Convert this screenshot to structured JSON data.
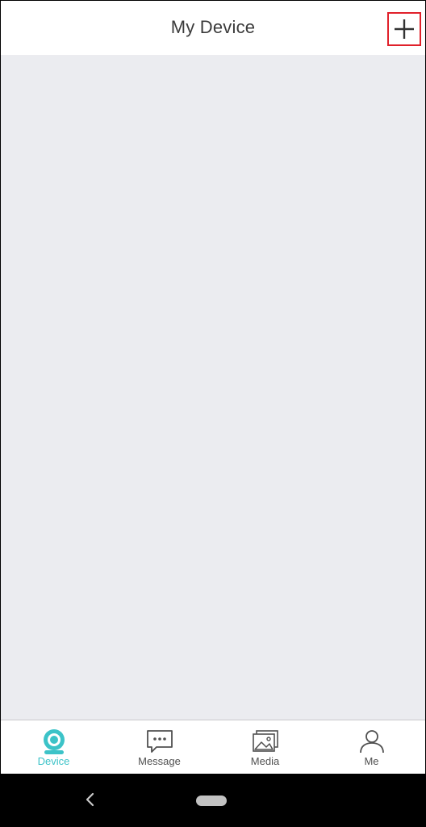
{
  "header": {
    "title": "My Device",
    "add_icon": "plus-icon"
  },
  "tabs": [
    {
      "label": "Device",
      "icon": "camera-icon",
      "active": true
    },
    {
      "label": "Message",
      "icon": "chat-bubble-icon",
      "active": false
    },
    {
      "label": "Media",
      "icon": "gallery-icon",
      "active": false
    },
    {
      "label": "Me",
      "icon": "user-icon",
      "active": false
    }
  ],
  "colors": {
    "accent": "#3cc3c8",
    "highlight_box": "#e0202a",
    "content_bg": "#ebecf0"
  }
}
